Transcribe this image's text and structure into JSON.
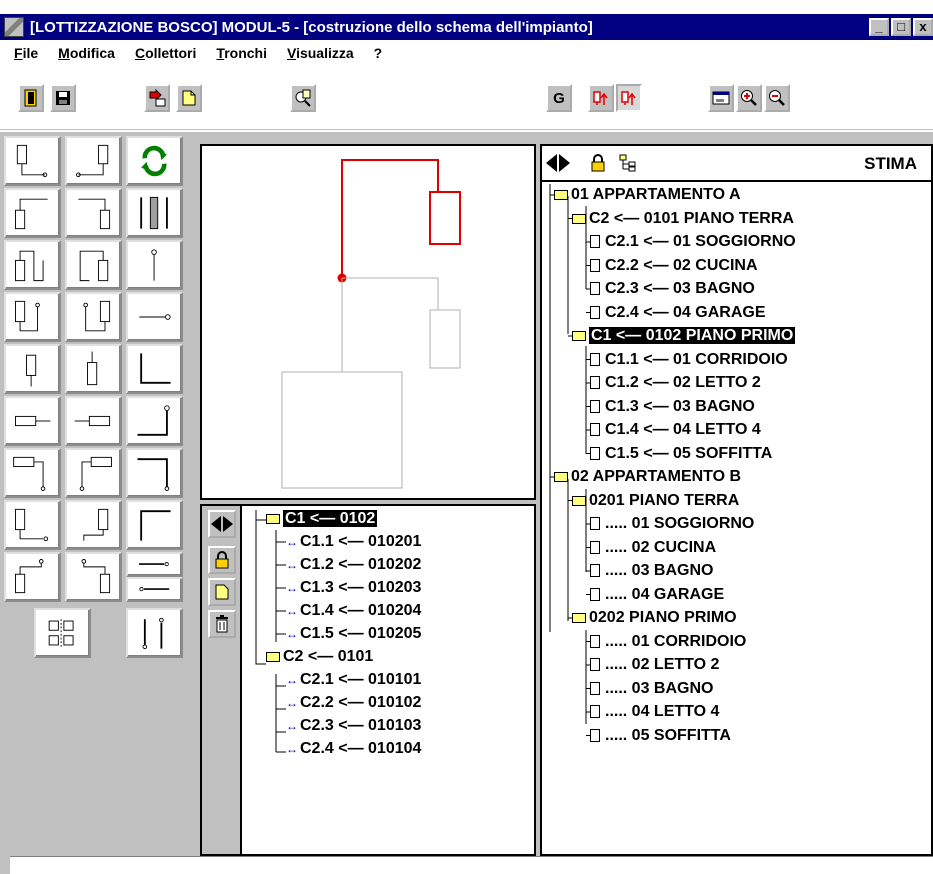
{
  "window": {
    "title": "[LOTTIZZAZIONE BOSCO] MODUL-5 - [costruzione dello schema dell'impianto]",
    "controls": [
      "_",
      "□",
      "x"
    ]
  },
  "menu": [
    {
      "first": "F",
      "rest": "ile"
    },
    {
      "first": "M",
      "rest": "odifica"
    },
    {
      "first": "C",
      "rest": "ollettori"
    },
    {
      "first": "T",
      "rest": "ronchi"
    },
    {
      "first": "V",
      "rest": "isualizza"
    },
    {
      "first": "?",
      "rest": ""
    }
  ],
  "toolbar": {
    "g_label": "G",
    "icons": [
      "exit-icon",
      "save-icon",
      "import-icon",
      "new-doc-icon",
      "search-person-icon",
      "g-button",
      "branch-up-icon",
      "branch-up-pressed-icon",
      "window-icon",
      "zoom-in-icon",
      "zoom-out-icon"
    ]
  },
  "lower_tree": [
    {
      "label": "C1 <— 0102",
      "type": "folder",
      "selected": true
    },
    {
      "label": "C1.1 <— 010201",
      "type": "pipe"
    },
    {
      "label": "C1.2 <— 010202",
      "type": "pipe"
    },
    {
      "label": "C1.3 <— 010203",
      "type": "pipe"
    },
    {
      "label": "C1.4 <— 010204",
      "type": "pipe"
    },
    {
      "label": "C1.5 <— 010205",
      "type": "pipe"
    },
    {
      "label": "C2 <— 0101",
      "type": "folder"
    },
    {
      "label": "C2.1 <— 010101",
      "type": "pipe"
    },
    {
      "label": "C2.2 <— 010102",
      "type": "pipe"
    },
    {
      "label": "C2.3 <— 010103",
      "type": "pipe"
    },
    {
      "label": "C2.4 <— 010104",
      "type": "pipe"
    }
  ],
  "right_panel": {
    "header_label": "STIMA",
    "tree": [
      {
        "label": "01 APPARTAMENTO A",
        "type": "folder",
        "level": 0
      },
      {
        "label": "C2 <— 0101 PIANO TERRA",
        "type": "folder",
        "level": 1
      },
      {
        "label": "C2.1 <— 01 SOGGIORNO",
        "type": "doc",
        "level": 2
      },
      {
        "label": "C2.2 <— 02 CUCINA",
        "type": "doc",
        "level": 2
      },
      {
        "label": "C2.3 <— 03 BAGNO",
        "type": "doc",
        "level": 2
      },
      {
        "label": "C2.4 <— 04 GARAGE",
        "type": "doc",
        "level": 2
      },
      {
        "label": "C1 <— 0102 PIANO PRIMO",
        "type": "folder",
        "level": 1,
        "selected": true
      },
      {
        "label": "C1.1 <— 01 CORRIDOIO",
        "type": "doc",
        "level": 2
      },
      {
        "label": "C1.2 <— 02 LETTO 2",
        "type": "doc",
        "level": 2
      },
      {
        "label": "C1.3 <— 03 BAGNO",
        "type": "doc",
        "level": 2
      },
      {
        "label": "C1.4 <— 04 LETTO 4",
        "type": "doc",
        "level": 2
      },
      {
        "label": "C1.5 <— 05 SOFFITTA",
        "type": "doc",
        "level": 2
      },
      {
        "label": "02 APPARTAMENTO B",
        "type": "folder",
        "level": 0
      },
      {
        "label": "0201 PIANO TERRA",
        "type": "folder",
        "level": 1
      },
      {
        "label": "..... 01 SOGGIORNO",
        "type": "doc",
        "level": 2
      },
      {
        "label": "..... 02 CUCINA",
        "type": "doc",
        "level": 2
      },
      {
        "label": "..... 03 BAGNO",
        "type": "doc",
        "level": 2
      },
      {
        "label": "..... 04 GARAGE",
        "type": "doc",
        "level": 2
      },
      {
        "label": "0202 PIANO PRIMO",
        "type": "folder",
        "level": 1
      },
      {
        "label": "..... 01 CORRIDOIO",
        "type": "doc",
        "level": 2
      },
      {
        "label": "..... 02 LETTO 2",
        "type": "doc",
        "level": 2
      },
      {
        "label": "..... 03 BAGNO",
        "type": "doc",
        "level": 2
      },
      {
        "label": "..... 04 LETTO 4",
        "type": "doc",
        "level": 2
      },
      {
        "label": "..... 05 SOFFITTA",
        "type": "doc",
        "level": 2
      }
    ]
  },
  "colors": {
    "titlebar": "#000080",
    "highlight_pipe": "#e00000",
    "pipe_icon": "#0000c0",
    "face": "#c0c0c0"
  }
}
